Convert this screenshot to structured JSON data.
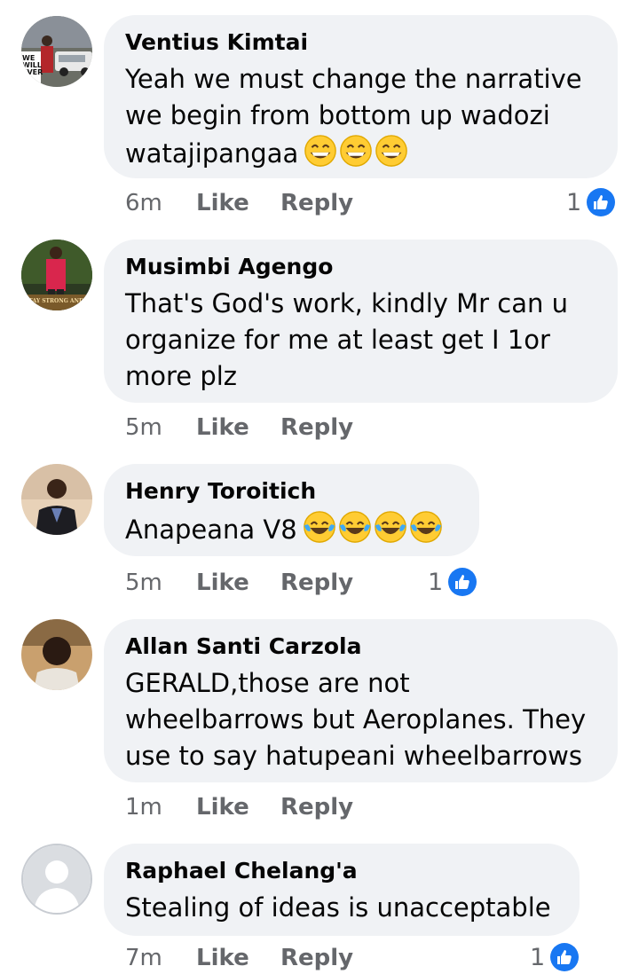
{
  "comments": [
    {
      "author": "Ventius Kimtai",
      "text": "Yeah we must change the narrative we begin from bottom up wadozi watajipangaa",
      "text_lines": [
        "Yeah we must change the narrative",
        "we begin from bottom up wadozi",
        "watajipangaa"
      ],
      "emojis": [
        "grinning-sweat-emoji",
        "grinning-sweat-emoji",
        "grinning-sweat-emoji"
      ],
      "time": "6m",
      "like_label": "Like",
      "reply_label": "Reply",
      "reaction_count": "1",
      "reaction_icon": "thumbs-up-icon"
    },
    {
      "author": "Musimbi Agengo",
      "text": "That's God's work, kindly Mr can u organize for me at least get I 1or more plz",
      "text_lines": [
        "That's God's work, kindly Mr can u",
        "organize for me at least get I 1or",
        "more plz"
      ],
      "avatar_text": "STAY STRONG AND",
      "time": "5m",
      "like_label": "Like",
      "reply_label": "Reply"
    },
    {
      "author": "Henry Toroitich",
      "text": "Anapeana V8",
      "emojis": [
        "tears-of-joy-emoji",
        "tears-of-joy-emoji",
        "tears-of-joy-emoji",
        "tears-of-joy-emoji"
      ],
      "time": "5m",
      "like_label": "Like",
      "reply_label": "Reply",
      "reaction_count": "1",
      "reaction_icon": "thumbs-up-icon"
    },
    {
      "author": "Allan Santi Carzola",
      "text": "GERALD,those are not wheelbarrows but Aeroplanes. They use to say hatupeani wheelbarrows",
      "text_lines": [
        "GERALD,those are not",
        "wheelbarrows but Aeroplanes. They",
        "use to say hatupeani wheelbarrows"
      ],
      "time": "1m",
      "like_label": "Like",
      "reply_label": "Reply"
    },
    {
      "author": "Raphael Chelang'a",
      "text": "Stealing of ideas is unacceptable",
      "time": "7m",
      "like_label": "Like",
      "reply_label": "Reply",
      "reaction_count": "1",
      "reaction_icon": "thumbs-up-icon"
    }
  ],
  "colors": {
    "bubble": "#f0f2f5",
    "meta_text": "#65676b",
    "like_blue": "#1877f2"
  }
}
